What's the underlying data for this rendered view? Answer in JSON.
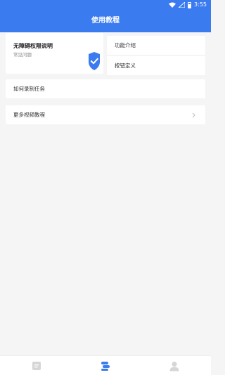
{
  "status_bar": {
    "time": "3:55"
  },
  "header": {
    "title": "使用教程"
  },
  "accessibility_card": {
    "title": "无障碍权限说明",
    "subtitle": "常见问题",
    "icon": "shield-check-icon",
    "accent": "#3b7bf0"
  },
  "right_cards": [
    {
      "label": "功能介绍"
    },
    {
      "label": "按钮定义"
    }
  ],
  "list": [
    {
      "label": "如何录制任务"
    },
    {
      "label": "更多视频教程"
    }
  ],
  "bottom_nav": [
    {
      "icon": "list-icon"
    },
    {
      "icon": "tutorial-icon",
      "active": true
    },
    {
      "icon": "user-icon"
    }
  ],
  "colors": {
    "primary": "#3b7bf0",
    "background": "#f5f5f5",
    "inactive_icon": "#d6d6d6"
  }
}
